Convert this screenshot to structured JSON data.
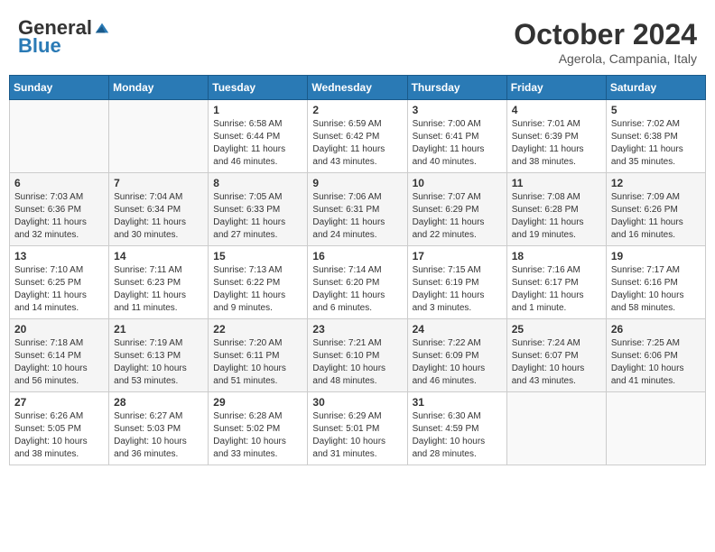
{
  "header": {
    "logo_general": "General",
    "logo_blue": "Blue",
    "month_title": "October 2024",
    "location": "Agerola, Campania, Italy"
  },
  "weekdays": [
    "Sunday",
    "Monday",
    "Tuesday",
    "Wednesday",
    "Thursday",
    "Friday",
    "Saturday"
  ],
  "weeks": [
    [
      {
        "day": "",
        "info": ""
      },
      {
        "day": "",
        "info": ""
      },
      {
        "day": "1",
        "info": "Sunrise: 6:58 AM\nSunset: 6:44 PM\nDaylight: 11 hours and 46 minutes."
      },
      {
        "day": "2",
        "info": "Sunrise: 6:59 AM\nSunset: 6:42 PM\nDaylight: 11 hours and 43 minutes."
      },
      {
        "day": "3",
        "info": "Sunrise: 7:00 AM\nSunset: 6:41 PM\nDaylight: 11 hours and 40 minutes."
      },
      {
        "day": "4",
        "info": "Sunrise: 7:01 AM\nSunset: 6:39 PM\nDaylight: 11 hours and 38 minutes."
      },
      {
        "day": "5",
        "info": "Sunrise: 7:02 AM\nSunset: 6:38 PM\nDaylight: 11 hours and 35 minutes."
      }
    ],
    [
      {
        "day": "6",
        "info": "Sunrise: 7:03 AM\nSunset: 6:36 PM\nDaylight: 11 hours and 32 minutes."
      },
      {
        "day": "7",
        "info": "Sunrise: 7:04 AM\nSunset: 6:34 PM\nDaylight: 11 hours and 30 minutes."
      },
      {
        "day": "8",
        "info": "Sunrise: 7:05 AM\nSunset: 6:33 PM\nDaylight: 11 hours and 27 minutes."
      },
      {
        "day": "9",
        "info": "Sunrise: 7:06 AM\nSunset: 6:31 PM\nDaylight: 11 hours and 24 minutes."
      },
      {
        "day": "10",
        "info": "Sunrise: 7:07 AM\nSunset: 6:29 PM\nDaylight: 11 hours and 22 minutes."
      },
      {
        "day": "11",
        "info": "Sunrise: 7:08 AM\nSunset: 6:28 PM\nDaylight: 11 hours and 19 minutes."
      },
      {
        "day": "12",
        "info": "Sunrise: 7:09 AM\nSunset: 6:26 PM\nDaylight: 11 hours and 16 minutes."
      }
    ],
    [
      {
        "day": "13",
        "info": "Sunrise: 7:10 AM\nSunset: 6:25 PM\nDaylight: 11 hours and 14 minutes."
      },
      {
        "day": "14",
        "info": "Sunrise: 7:11 AM\nSunset: 6:23 PM\nDaylight: 11 hours and 11 minutes."
      },
      {
        "day": "15",
        "info": "Sunrise: 7:13 AM\nSunset: 6:22 PM\nDaylight: 11 hours and 9 minutes."
      },
      {
        "day": "16",
        "info": "Sunrise: 7:14 AM\nSunset: 6:20 PM\nDaylight: 11 hours and 6 minutes."
      },
      {
        "day": "17",
        "info": "Sunrise: 7:15 AM\nSunset: 6:19 PM\nDaylight: 11 hours and 3 minutes."
      },
      {
        "day": "18",
        "info": "Sunrise: 7:16 AM\nSunset: 6:17 PM\nDaylight: 11 hours and 1 minute."
      },
      {
        "day": "19",
        "info": "Sunrise: 7:17 AM\nSunset: 6:16 PM\nDaylight: 10 hours and 58 minutes."
      }
    ],
    [
      {
        "day": "20",
        "info": "Sunrise: 7:18 AM\nSunset: 6:14 PM\nDaylight: 10 hours and 56 minutes."
      },
      {
        "day": "21",
        "info": "Sunrise: 7:19 AM\nSunset: 6:13 PM\nDaylight: 10 hours and 53 minutes."
      },
      {
        "day": "22",
        "info": "Sunrise: 7:20 AM\nSunset: 6:11 PM\nDaylight: 10 hours and 51 minutes."
      },
      {
        "day": "23",
        "info": "Sunrise: 7:21 AM\nSunset: 6:10 PM\nDaylight: 10 hours and 48 minutes."
      },
      {
        "day": "24",
        "info": "Sunrise: 7:22 AM\nSunset: 6:09 PM\nDaylight: 10 hours and 46 minutes."
      },
      {
        "day": "25",
        "info": "Sunrise: 7:24 AM\nSunset: 6:07 PM\nDaylight: 10 hours and 43 minutes."
      },
      {
        "day": "26",
        "info": "Sunrise: 7:25 AM\nSunset: 6:06 PM\nDaylight: 10 hours and 41 minutes."
      }
    ],
    [
      {
        "day": "27",
        "info": "Sunrise: 6:26 AM\nSunset: 5:05 PM\nDaylight: 10 hours and 38 minutes."
      },
      {
        "day": "28",
        "info": "Sunrise: 6:27 AM\nSunset: 5:03 PM\nDaylight: 10 hours and 36 minutes."
      },
      {
        "day": "29",
        "info": "Sunrise: 6:28 AM\nSunset: 5:02 PM\nDaylight: 10 hours and 33 minutes."
      },
      {
        "day": "30",
        "info": "Sunrise: 6:29 AM\nSunset: 5:01 PM\nDaylight: 10 hours and 31 minutes."
      },
      {
        "day": "31",
        "info": "Sunrise: 6:30 AM\nSunset: 4:59 PM\nDaylight: 10 hours and 28 minutes."
      },
      {
        "day": "",
        "info": ""
      },
      {
        "day": "",
        "info": ""
      }
    ]
  ]
}
